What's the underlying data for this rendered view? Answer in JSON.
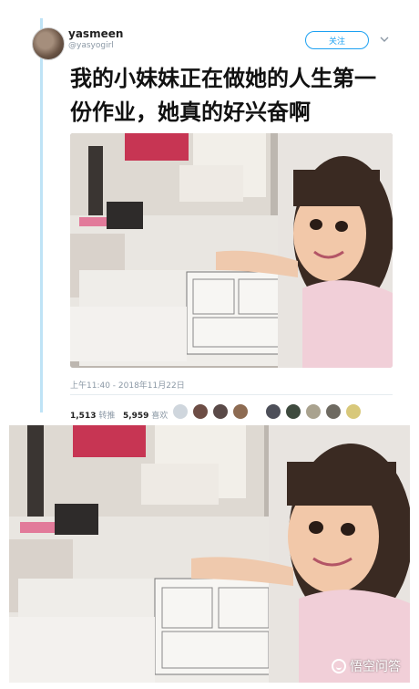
{
  "tweet": {
    "user_name": "yasmeen",
    "user_handle": "@yasyogirl",
    "follow_label": "关注",
    "text": "我的小妹妹正在做她的人生第一份作业，她真的好兴奋啊",
    "timestamp": "上午11:40 - 2018年11月22日",
    "retweets_count": "1,513",
    "retweets_label": "转推",
    "likes_count": "5,959",
    "likes_label": "喜欢"
  },
  "watermark": {
    "text": "悟空问答"
  },
  "colors": {
    "accent": "#1da1f2",
    "muted": "#8b98a5",
    "thread_line": "#bfe3f6"
  },
  "icons": {
    "chevron": "chevron-down-icon",
    "watermark_logo": "wukong-logo-icon"
  }
}
